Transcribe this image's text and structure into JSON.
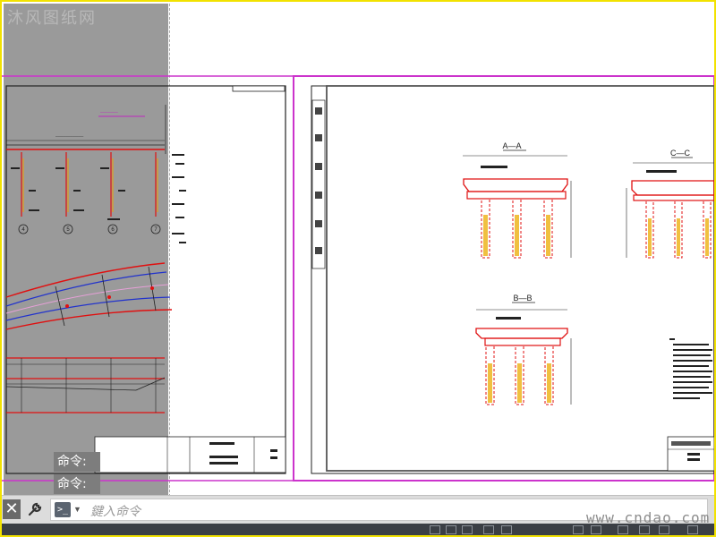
{
  "watermark_top": "沐风图纸网",
  "command_history": [
    "命令:",
    "命令:"
  ],
  "command_line": {
    "placeholder": "鍵入命令",
    "close_glyph": "✕"
  },
  "site_watermark": "www.cndao.com",
  "drawing": {
    "left_sheet": {
      "axis_labels": [
        "4",
        "5",
        "6",
        "7"
      ]
    },
    "right_sheet": {
      "section_titles": [
        "A—A",
        "C—C",
        "B—B"
      ]
    }
  },
  "colors": {
    "frame": "#f2e200",
    "viewport_border": "#cc33cc",
    "drawing_red": "#e01010",
    "drawing_blue": "#2233cc",
    "gray_area": "#9a9a9a"
  }
}
